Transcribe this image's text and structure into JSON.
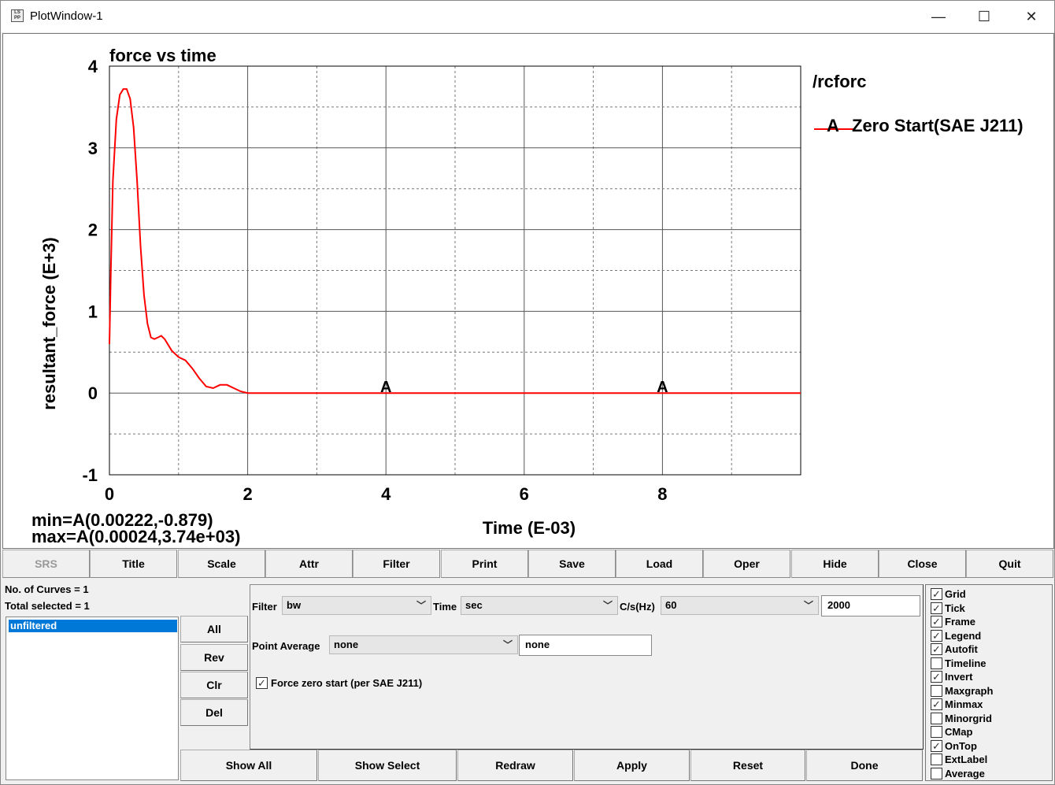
{
  "window": {
    "title": "PlotWindow-1",
    "icon_text": "LS PP",
    "controls": {
      "minimize": "—",
      "maximize": "☐",
      "close": "✕"
    }
  },
  "plot": {
    "title": "force vs time",
    "xlabel": "Time (E-03)",
    "ylabel": "resultant_force (E+3)",
    "source": "/rcforc",
    "legend": [
      {
        "marker": "A",
        "label": "Zero Start(SAE J211)",
        "color": "#ff0000"
      }
    ],
    "minmax": {
      "min": "min=A(0.00222,-0.879)",
      "max": "max=A(0.00024,3.74e+03)"
    }
  },
  "chart_data": {
    "type": "line",
    "title": "force vs time",
    "xlabel": "Time (E-03)",
    "ylabel": "resultant_force (E+3)",
    "xlim": [
      0,
      10
    ],
    "ylim": [
      -1,
      4
    ],
    "xticks": [
      "0",
      "2",
      "4",
      "6",
      "8"
    ],
    "yticks": [
      "-1",
      "0",
      "1",
      "2",
      "3",
      "4"
    ],
    "grid": true,
    "legend_position": "right",
    "series": [
      {
        "name": "Zero Start(SAE J211)",
        "marker": "A",
        "color": "#ff0000",
        "x": [
          0,
          0.02,
          0.05,
          0.1,
          0.15,
          0.2,
          0.25,
          0.3,
          0.35,
          0.4,
          0.45,
          0.5,
          0.55,
          0.6,
          0.65,
          0.7,
          0.75,
          0.8,
          0.9,
          1.0,
          1.1,
          1.2,
          1.3,
          1.4,
          1.5,
          1.6,
          1.7,
          1.8,
          1.9,
          2.0,
          2.1,
          3,
          4,
          5,
          6,
          7,
          8,
          9,
          10
        ],
        "y": [
          0.6,
          1.5,
          2.6,
          3.35,
          3.65,
          3.72,
          3.72,
          3.6,
          3.25,
          2.6,
          1.8,
          1.2,
          0.85,
          0.68,
          0.66,
          0.68,
          0.7,
          0.66,
          0.52,
          0.44,
          0.4,
          0.3,
          0.18,
          0.08,
          0.06,
          0.1,
          0.1,
          0.06,
          0.02,
          0.0,
          0.0,
          0.0,
          0.0,
          0.0,
          0.0,
          0.0,
          0.0,
          0.0,
          0.0
        ],
        "markers_at_x": [
          4,
          8
        ]
      }
    ]
  },
  "toolbar": {
    "buttons": [
      "SRS",
      "Title",
      "Scale",
      "Attr",
      "Filter",
      "Print",
      "Save",
      "Load",
      "Oper",
      "Hide",
      "Close",
      "Quit"
    ]
  },
  "curves_panel": {
    "count_text": "No. of Curves = 1",
    "selected_text": "Total selected = 1",
    "items": [
      "unfiltered"
    ],
    "side_buttons": [
      "All",
      "Rev",
      "Clr",
      "Del"
    ]
  },
  "filter_panel": {
    "filter_label": "Filter",
    "filter_value": "bw",
    "time_label": "Time",
    "time_value": "sec",
    "cfc_label": "C/s(Hz)",
    "cfc_value": "60",
    "rate_value": "2000",
    "point_avg_label": "Point Average",
    "point_avg_value": "none",
    "point_avg_text": "none",
    "zero_start_label": "Force zero start (per SAE J211)",
    "zero_start_checked": true
  },
  "action_buttons": [
    "Show All",
    "Show Select",
    "Redraw",
    "Apply",
    "Reset",
    "Done"
  ],
  "options": [
    {
      "label": "Grid",
      "checked": true
    },
    {
      "label": "Tick",
      "checked": true
    },
    {
      "label": "Frame",
      "checked": true
    },
    {
      "label": "Legend",
      "checked": true
    },
    {
      "label": "Autofit",
      "checked": true
    },
    {
      "label": "Timeline",
      "checked": false
    },
    {
      "label": "Invert",
      "checked": true
    },
    {
      "label": "Maxgraph",
      "checked": false
    },
    {
      "label": "Minmax",
      "checked": true
    },
    {
      "label": "Minorgrid",
      "checked": false
    },
    {
      "label": "CMap",
      "checked": false
    },
    {
      "label": "OnTop",
      "checked": true
    },
    {
      "label": "ExtLabel",
      "checked": false
    },
    {
      "label": "Average",
      "checked": false
    }
  ]
}
